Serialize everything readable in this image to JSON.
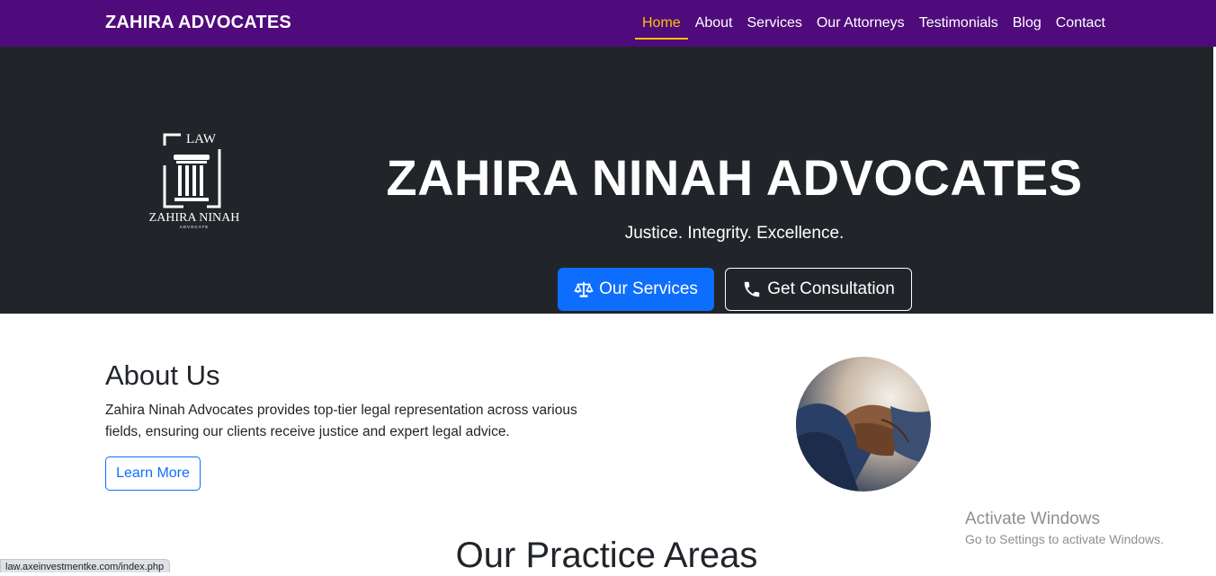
{
  "navbar": {
    "brand": "ZAHIRA ADVOCATES",
    "links": [
      "Home",
      "About",
      "Services",
      "Our Attorneys",
      "Testimonials",
      "Blog",
      "Contact"
    ],
    "active": "Home",
    "bg_color": "#4f0b7b",
    "active_color": "#ffc107"
  },
  "hero": {
    "logo": {
      "top_text": "LAW",
      "name": "ZAHIRA NINAH",
      "sub": "ADVOCATE"
    },
    "title": "ZAHIRA NINAH ADVOCATES",
    "tagline": "Justice. Integrity. Excellence.",
    "primary_button": {
      "label": "Our Services",
      "icon": "scale-balance-icon",
      "color": "#0d6efd"
    },
    "secondary_button": {
      "label": "Get Consultation",
      "icon": "phone-icon"
    },
    "bg_color": "#212529"
  },
  "about": {
    "title": "About Us",
    "text": "Zahira Ninah Advocates provides top-tier legal representation across various fields, ensuring our clients receive justice and expert legal advice.",
    "button": "Learn More",
    "image": "handshake-image"
  },
  "practice": {
    "title": "Our Practice Areas"
  },
  "overlay": {
    "activate_title": "Activate Windows",
    "activate_sub": "Go to Settings to activate Windows."
  },
  "status_bar": {
    "url": "law.axeinvestmentke.com/index.php"
  }
}
